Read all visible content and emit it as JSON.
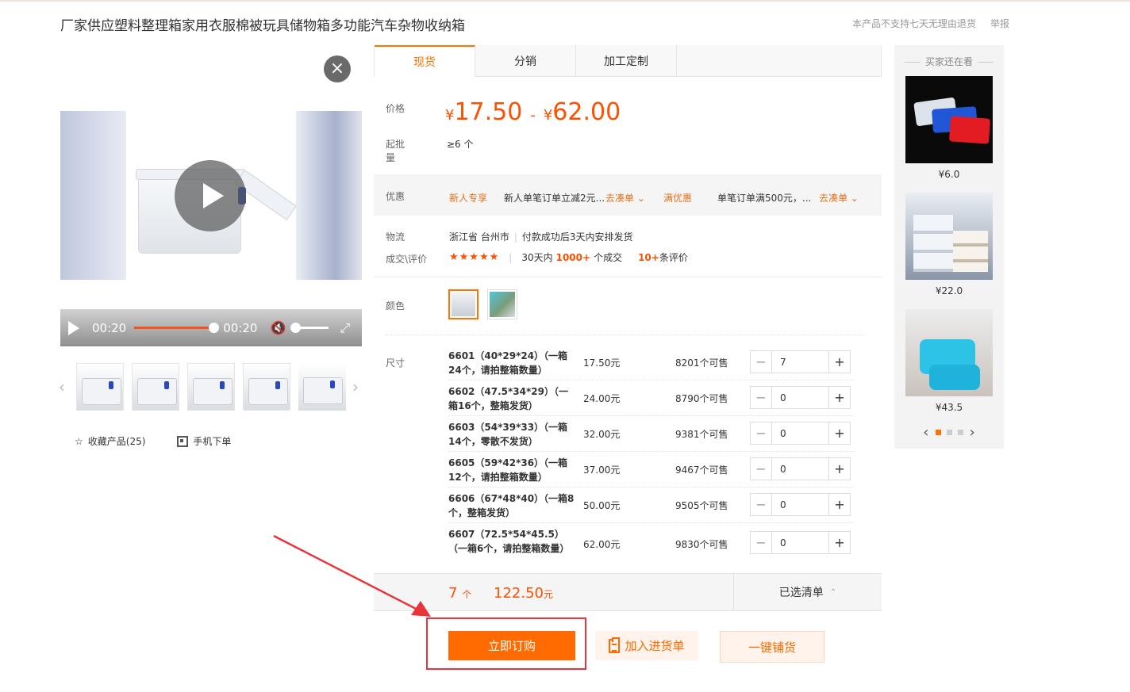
{
  "product": {
    "title": "厂家供应塑料整理箱家用衣服棉被玩具储物箱多功能汽车杂物收纳箱",
    "no_return": "本产品不支持七天无理由退货",
    "report": "举报"
  },
  "media": {
    "close_glyph": "×",
    "time_current": "00:20",
    "time_total": "00:20",
    "thumb_prev": "‹",
    "thumb_next": "›",
    "favorite": "收藏产品(25)",
    "mobile_order": "手机下单"
  },
  "tabs": [
    {
      "label": "现货"
    },
    {
      "label": "分销"
    },
    {
      "label": "加工定制"
    }
  ],
  "price": {
    "label": "价格",
    "currency": "¥",
    "low": "17.50",
    "dash": "-",
    "high": "62.00",
    "moq_label": "起批量",
    "moq": "≥6 个"
  },
  "promo": {
    "label": "优惠",
    "tag1": "新人专享",
    "text1": "新人单笔订单立减2元...",
    "link1": "去凑单 ⌄",
    "tag2": "满优惠",
    "text2": "单笔订单满500元，...",
    "link2": "去凑单 ⌄"
  },
  "logistics": {
    "label": "物流",
    "origin": "浙江省 台州市",
    "sep": "|",
    "ship": "付款成功后3天内安排发货",
    "review_label": "成交\\评价",
    "stars": "★★★★★",
    "deal_prefix": "30天内",
    "deal_count": "1000+",
    "deal_suffix": "个成交",
    "review_count": "10+",
    "review_suffix": "条评价"
  },
  "color": {
    "label": "颜色"
  },
  "size": {
    "label": "尺寸",
    "rows": [
      {
        "name": "6601（40*29*24）（一箱24个，请拍整箱数量）",
        "price": "17.50元",
        "stock": "8201个可售",
        "qty": "7"
      },
      {
        "name": "6602（47.5*34*29）（一箱16个，整箱发货）",
        "price": "24.00元",
        "stock": "8790个可售",
        "qty": "0"
      },
      {
        "name": "6603（54*39*33）（一箱14个，零散不发货）",
        "price": "32.00元",
        "stock": "9381个可售",
        "qty": "0"
      },
      {
        "name": "6605（59*42*36）（一箱12个，请拍整箱数量）",
        "price": "37.00元",
        "stock": "9467个可售",
        "qty": "0"
      },
      {
        "name": "6606（67*48*40）（一箱8个，整箱发货）",
        "price": "50.00元",
        "stock": "9505个可售",
        "qty": "0"
      },
      {
        "name": "6607（72.5*54*45.5）（一箱6个，请拍整箱数量）",
        "price": "62.00元",
        "stock": "9830个可售",
        "qty": "0"
      }
    ],
    "minus": "−",
    "plus": "+"
  },
  "summary": {
    "qty": "7",
    "qty_unit": "个",
    "amount": "122.50",
    "amount_unit": "元",
    "selected_list": "已选清单",
    "up": "⌃"
  },
  "actions": {
    "buy": "立即订购",
    "cart": "加入进货单",
    "distribute": "一键铺货"
  },
  "recommend": {
    "title": "买家还在看",
    "items": [
      {
        "price": "¥6.0"
      },
      {
        "price": "¥22.0"
      },
      {
        "price": "¥43.5"
      }
    ],
    "prev": "‹",
    "next": "›"
  },
  "colors": {
    "accent": "#ff7300",
    "price": "#ff5000",
    "promo": "#e5721b",
    "highlight_box": "#e8343a"
  }
}
